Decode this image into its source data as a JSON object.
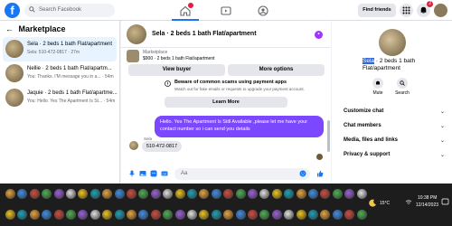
{
  "topbar": {
    "logo": "f",
    "search_placeholder": "Search Facebook",
    "find_friends": "Find friends",
    "notifications_count": "2"
  },
  "marketplace": {
    "title": "Marketplace",
    "conversations": [
      {
        "title": "Sela · 2 beds 1 bath Flat/apartment",
        "preview": "Sela: 510-472-0817 · 27m",
        "active": true
      },
      {
        "title": "Nellie · 2 beds 1 bath Flat/apartm...",
        "preview": "You: Thanks. I'M message you in a... · 54m",
        "active": false
      },
      {
        "title": "Jaquie · 2 beds 1 bath Flat/apartme...",
        "preview": "You: Hello. Yes The Apartment Is St... · 54m",
        "active": false
      }
    ]
  },
  "chat": {
    "title": "Sela · 2 beds 1 bath Flat/apartment",
    "listing_source": "Marketplace",
    "listing_text": "$900 · 2 beds 1 bath Flat/apartment",
    "view_buyer": "View buyer",
    "more_options": "More options",
    "scam_heading": "Beware of common scams using payment apps",
    "scam_body": "Watch out for fake emails or requests to upgrade your payment account.",
    "learn_more": "Learn More",
    "outgoing_message": "Hello. Yes The Apartment Is Still Available ,please let me have your contact number so i can send you details",
    "sender_name": "Sela",
    "incoming_message": "510-472-0817",
    "composer_placeholder": "Aa"
  },
  "profile": {
    "name_highlight": "Sela",
    "name_rest": " · 2 beds 1 bath Flat/apartment",
    "mute": "Mute",
    "search": "Search",
    "sections": [
      "Customize chat",
      "Chat members",
      "Media, files and links",
      "Privacy & support"
    ]
  },
  "taskbar": {
    "temperature": "15°C",
    "time": "10:38 PM",
    "date": "12/14/2023"
  },
  "colors": {
    "accent": "#1877f2",
    "bubble": "#7b47ff",
    "taskbar": "#1d1d1d"
  }
}
